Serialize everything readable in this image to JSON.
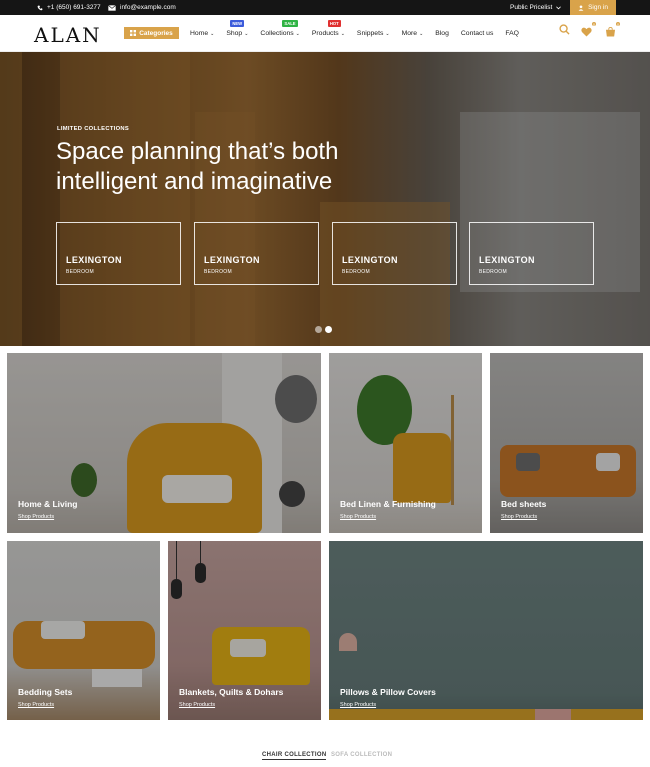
{
  "topbar": {
    "phone": "+1 (650) 691-3277",
    "email": "info@example.com",
    "pricelist": "Public Pricelist",
    "signin": "Sign in"
  },
  "header": {
    "logo": "ALAN",
    "categories_label": "Categories",
    "nav": [
      {
        "label": "Home",
        "dropdown": true,
        "badge": ""
      },
      {
        "label": "Shop",
        "dropdown": true,
        "badge": "NEW"
      },
      {
        "label": "Collections",
        "dropdown": true,
        "badge": "SALE"
      },
      {
        "label": "Products",
        "dropdown": true,
        "badge": "HOT"
      },
      {
        "label": "Snippets",
        "dropdown": true,
        "badge": ""
      },
      {
        "label": "More",
        "dropdown": true,
        "badge": ""
      },
      {
        "label": "Blog",
        "dropdown": false,
        "badge": ""
      },
      {
        "label": "Contact us",
        "dropdown": false,
        "badge": ""
      },
      {
        "label": "FAQ",
        "dropdown": false,
        "badge": ""
      }
    ],
    "wishlist_count": "0",
    "cart_count": "0"
  },
  "hero": {
    "eyebrow": "LIMITED COLLECTIONS",
    "title": "Space planning that’s both intelligent and imaginative",
    "cards": [
      {
        "title": "LEXINGTON",
        "subtitle": "BEDROOM"
      },
      {
        "title": "LEXINGTON",
        "subtitle": "BEDROOM"
      },
      {
        "title": "LEXINGTON",
        "subtitle": "BEDROOM"
      },
      {
        "title": "LEXINGTON",
        "subtitle": "BEDROOM"
      }
    ],
    "slide_count": 2,
    "active_slide": 2
  },
  "collections": [
    {
      "title": "Home & Living",
      "link": "Shop Products"
    },
    {
      "title": "Bed Linen & Furnishing",
      "link": "Shop Products"
    },
    {
      "title": "Bed sheets",
      "link": "Shop Products"
    },
    {
      "title": "Bedding Sets",
      "link": "Shop Products"
    },
    {
      "title": "Blankets, Quilts & Dohars",
      "link": "Shop Products"
    },
    {
      "title": "Pillows & Pillow Covers",
      "link": "Shop Products"
    }
  ],
  "tabs": {
    "active": "CHAIR COLLECTION",
    "inactive": "SOFA COLLECTION"
  },
  "colors": {
    "accent": "#d9a34a",
    "topbar": "#151515",
    "badge_new": "#3b5bdb",
    "badge_sale": "#2fb344",
    "badge_hot": "#e03131"
  }
}
